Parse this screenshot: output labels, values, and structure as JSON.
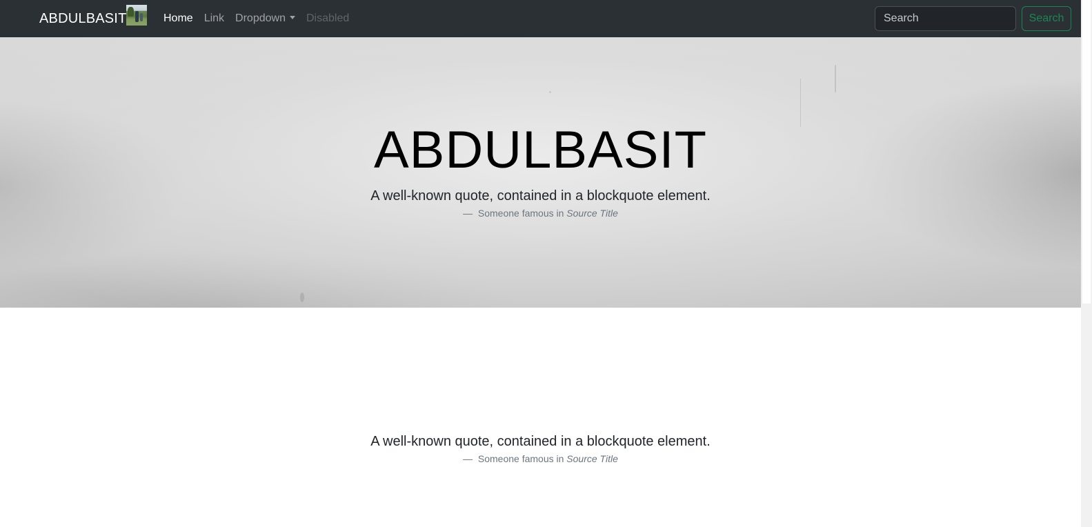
{
  "navbar": {
    "brand": "ABDULBASIT",
    "links": [
      {
        "label": "Home",
        "state": "active"
      },
      {
        "label": "Link",
        "state": "normal"
      },
      {
        "label": "Dropdown",
        "state": "dropdown"
      },
      {
        "label": "Disabled",
        "state": "disabled"
      }
    ],
    "search": {
      "placeholder": "Search",
      "button_label": "Search"
    }
  },
  "hero": {
    "title": "ABDULBASIT",
    "quote": "A well-known quote, contained in a blockquote element.",
    "cite_prefix": "Someone famous in ",
    "cite_source": "Source Title"
  },
  "section": {
    "quote": "A well-known quote, contained in a blockquote element.",
    "cite_prefix": "Someone famous in ",
    "cite_source": "Source Title"
  },
  "colors": {
    "navbar_bg": "#2b3035",
    "success": "#198754",
    "muted": "#6c757d"
  }
}
